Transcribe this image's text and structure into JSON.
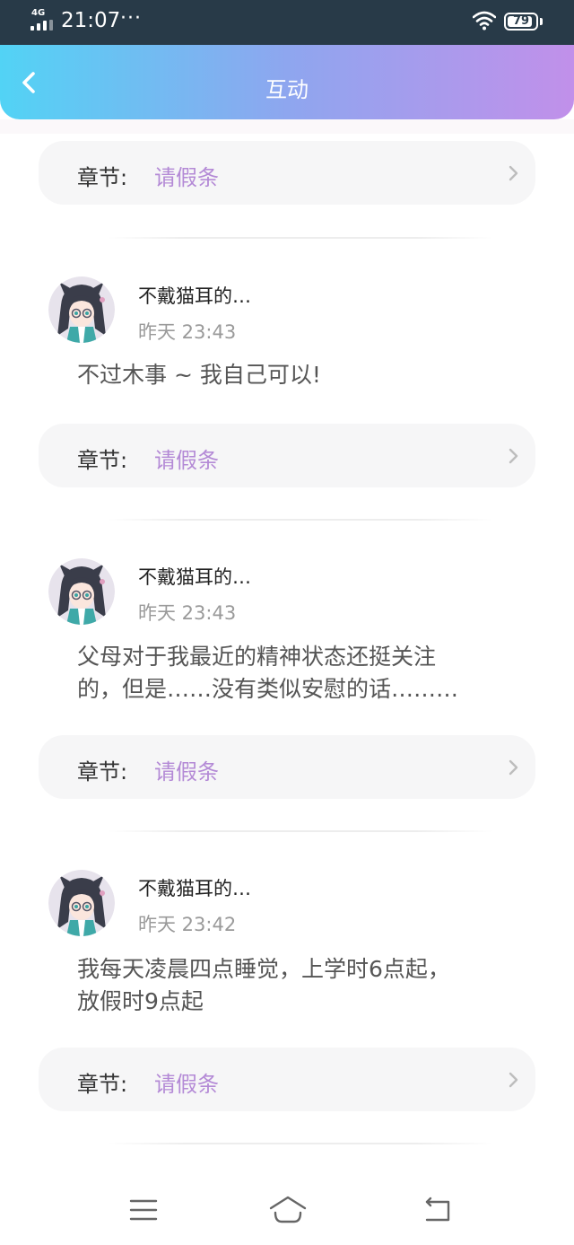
{
  "status_bar": {
    "network": "4G",
    "time": "21:07",
    "dots": "···",
    "battery": "79"
  },
  "header": {
    "title": "互动",
    "back_icon": "chevron-left-icon"
  },
  "colors": {
    "header_gradient": [
      "#52d3f5",
      "#8ea6ef",
      "#c190ea"
    ],
    "chapter_accent": "#b48ad6"
  },
  "chapter_label": "章节:",
  "top_chapter": {
    "value": "请假条"
  },
  "comments": [
    {
      "username": "不戴猫耳的…",
      "time": "昨天 23:43",
      "message_lines": [
        "不过木事 ~ 我自己可以!"
      ],
      "chapter": "请假条"
    },
    {
      "username": "不戴猫耳的…",
      "time": "昨天 23:43",
      "message_lines": [
        "父母对于我最近的精神状态还挺关注",
        "的，但是……没有类似安慰的话………"
      ],
      "chapter": "请假条"
    },
    {
      "username": "不戴猫耳的…",
      "time": "昨天 23:42",
      "message_lines": [
        "我每天凌晨四点睡觉，上学时6点起，",
        "放假时9点起"
      ],
      "chapter": "请假条"
    }
  ],
  "nav": {
    "menu_icon": "menu-icon",
    "home_icon": "home-icon",
    "back_icon": "back-icon"
  }
}
